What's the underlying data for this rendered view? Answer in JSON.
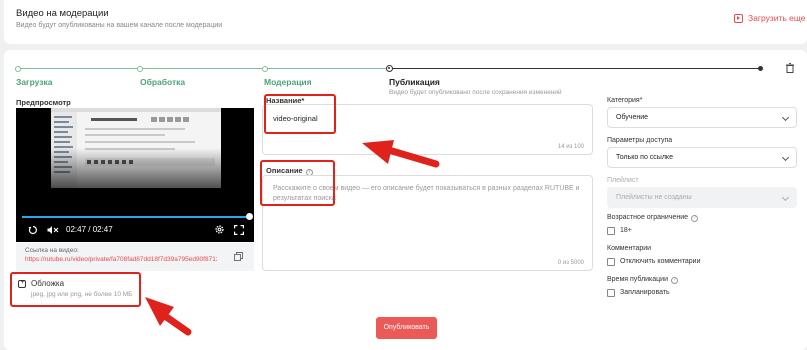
{
  "header": {
    "title": "Видео на модерации",
    "subtitle": "Видео будут опубликованы на вашем канале после модерации",
    "reload_label": "Загрузить еще"
  },
  "stepper": {
    "steps": [
      {
        "label": "Загрузка",
        "state": "done"
      },
      {
        "label": "Обработка",
        "state": "done"
      },
      {
        "label": "Модерация",
        "state": "done"
      },
      {
        "label": "Публикация",
        "state": "current"
      }
    ],
    "current_sub": "Видео будет опубликовано после сохранения изменений"
  },
  "preview": {
    "title": "Предпросмотр",
    "time": "02:47 / 02:47",
    "link_label": "Ссылка на видео:",
    "link_url": "https://rutube.ru/video/private/fa708fad87dd18f7d39a795ed90f8713/?p=..."
  },
  "cover": {
    "title": "Обложка",
    "hint": "jpeg, jpg или png, не более 10 МБ"
  },
  "form": {
    "name_label": "Название*",
    "name_value": "video-original",
    "name_counter": "14 из 100",
    "desc_label": "Описание",
    "desc_placeholder": "Расскажите о своем видео — его описание будет показываться в разных разделах RUTUBE и результатах поиска",
    "desc_counter": "0 из 5000"
  },
  "settings": {
    "category_label": "Категория*",
    "category_value": "Обучение",
    "access_label": "Параметры доступа",
    "access_value": "Только по ссылке",
    "playlist_label": "Плейлист",
    "playlist_value": "Плейлисты не созданы",
    "age_label": "Возрастное ограничение",
    "age_option": "18+",
    "comments_label": "Комментарии",
    "comments_option": "Отключить комментарии",
    "time_label": "Время публикации",
    "time_option": "Запланировать"
  },
  "actions": {
    "publish_label": "Опубликовать"
  },
  "colors": {
    "accent": "#ec5a57",
    "done": "#4ca37a",
    "annotation": "#e0221d"
  }
}
